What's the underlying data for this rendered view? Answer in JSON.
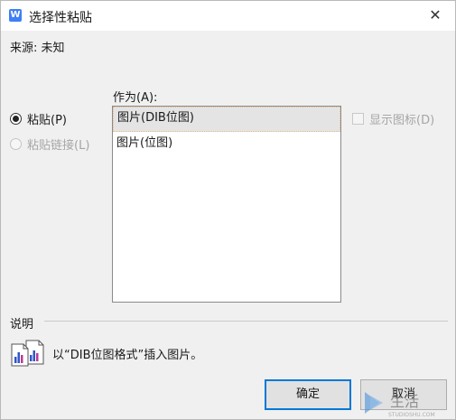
{
  "dialog": {
    "title": "选择性粘贴",
    "close_glyph": "✕",
    "app_icon_letter": "W",
    "source_text": "来源: 未知",
    "as_label": "作为(A):",
    "options": [
      {
        "label": "粘贴(P)",
        "checked": true,
        "disabled": false
      },
      {
        "label": "粘贴链接(L)",
        "checked": false,
        "disabled": true
      }
    ],
    "list_items": [
      "图片(DIB位图)",
      "图片(位图)"
    ],
    "selected_index": 0,
    "show_icon_label": "显示图标(D)",
    "description_label": "说明",
    "description_text": "以“DIB位图格式”插入图片。",
    "ok_label": "确定",
    "cancel_label": "取消"
  },
  "watermark": {
    "text": "生活",
    "sub": "STUDIOSHU.COM"
  },
  "colors": {
    "accent": "#0078d7",
    "app_icon": "#3d7ff5",
    "dialog_bg": "#f0f0f0"
  }
}
